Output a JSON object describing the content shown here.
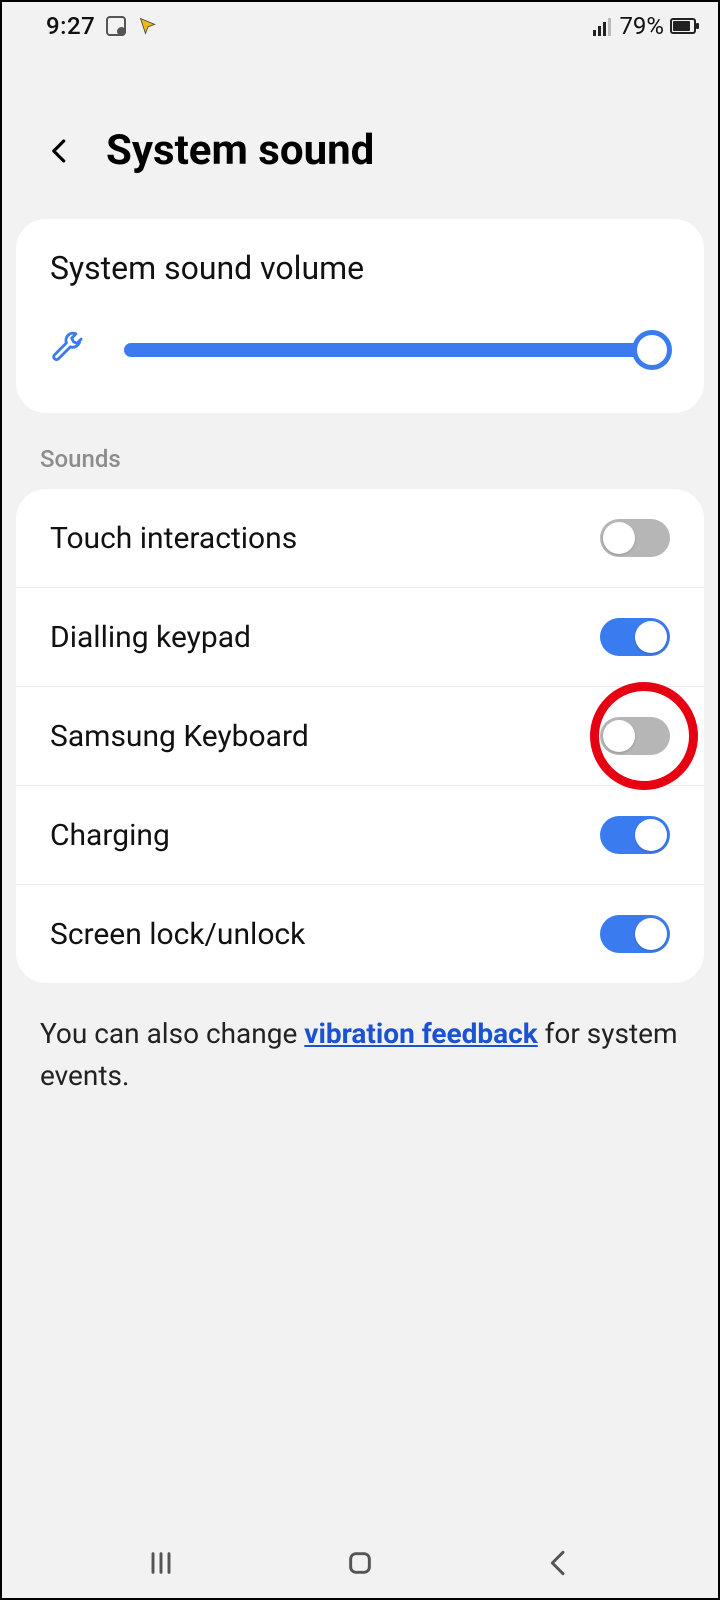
{
  "status": {
    "time": "9:27",
    "battery_pct": "79%"
  },
  "header": {
    "title": "System sound"
  },
  "volume": {
    "label": "System sound volume",
    "value_pct": 100
  },
  "sections": {
    "sounds_label": "Sounds"
  },
  "toggles": [
    {
      "id": "touch-interactions",
      "label": "Touch interactions",
      "state": "off",
      "highlighted": false
    },
    {
      "id": "dialling-keypad",
      "label": "Dialling keypad",
      "state": "on",
      "highlighted": false
    },
    {
      "id": "samsung-keyboard",
      "label": "Samsung Keyboard",
      "state": "off",
      "highlighted": true
    },
    {
      "id": "charging",
      "label": "Charging",
      "state": "on",
      "highlighted": false
    },
    {
      "id": "screen-lock-unlock",
      "label": "Screen lock/unlock",
      "state": "on",
      "highlighted": false
    }
  ],
  "footer": {
    "pre": "You can also change ",
    "link": "vibration feedback",
    "post": " for system events."
  }
}
